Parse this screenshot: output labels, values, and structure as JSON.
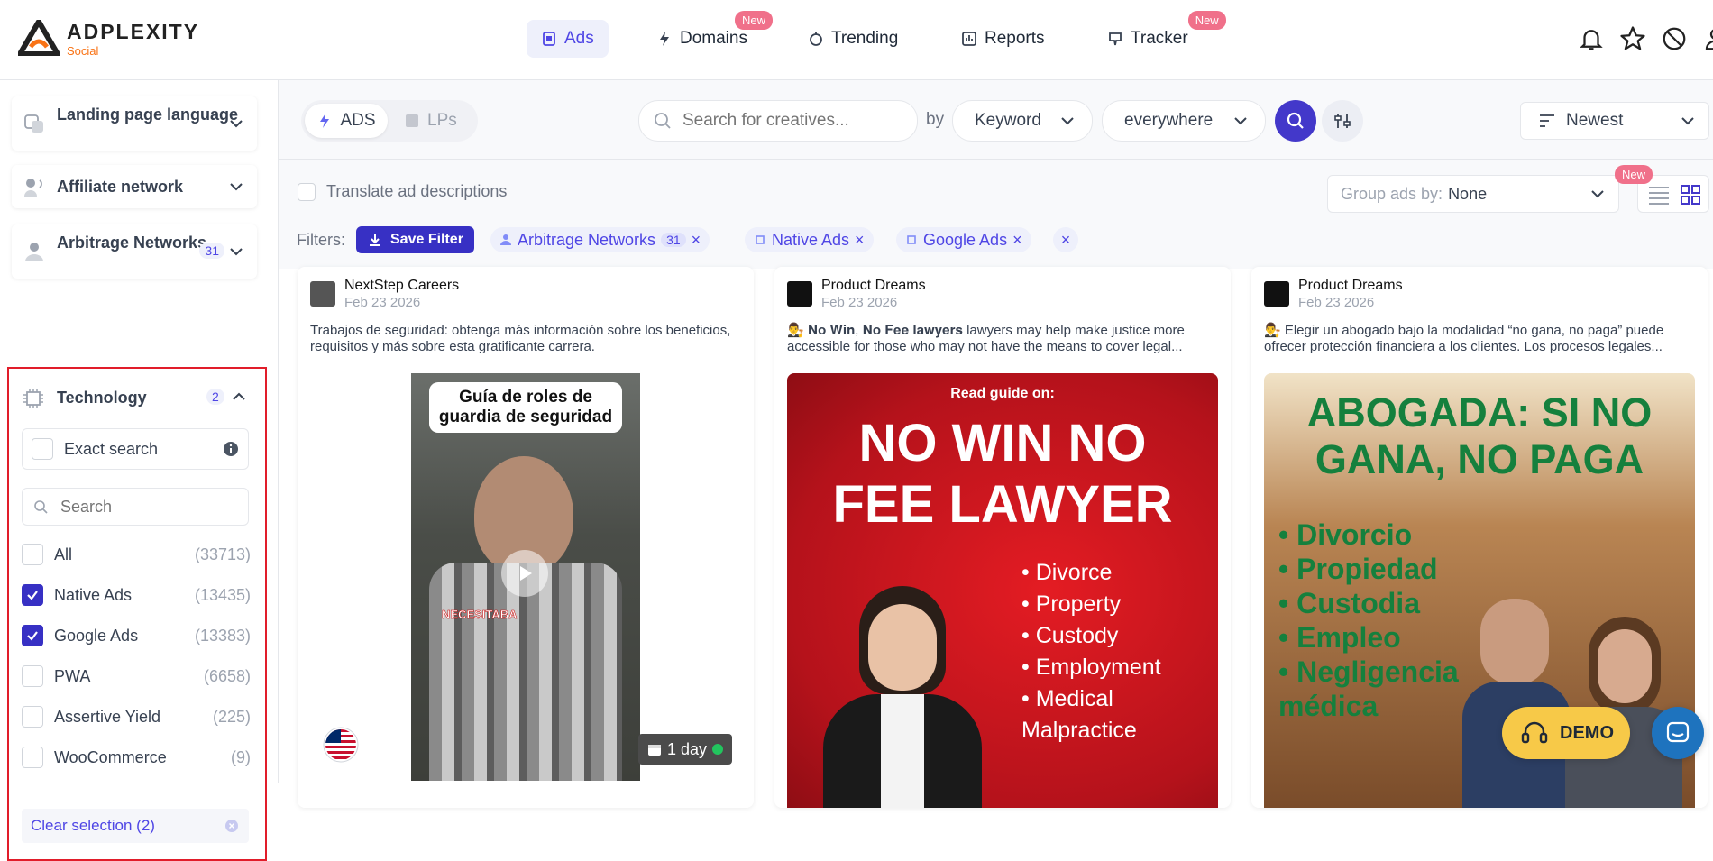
{
  "brand": {
    "name": "ADPLEXITY",
    "sub": "Social"
  },
  "nav": [
    {
      "label": "Ads",
      "active": true
    },
    {
      "label": "Domains",
      "badge": "New"
    },
    {
      "label": "Trending"
    },
    {
      "label": "Reports"
    },
    {
      "label": "Tracker",
      "badge": "New"
    }
  ],
  "sidebar": {
    "landing_language": "Landing page language",
    "affiliate_network": "Affiliate network",
    "arbitrage": {
      "label": "Arbitrage Networks",
      "count": "31"
    },
    "technology": {
      "label": "Technology",
      "count": "2",
      "exact_search": "Exact search",
      "search_placeholder": "Search",
      "options": [
        {
          "label": "All",
          "count": "(33713)",
          "checked": false
        },
        {
          "label": "Native Ads",
          "count": "(13435)",
          "checked": true
        },
        {
          "label": "Google Ads",
          "count": "(13383)",
          "checked": true
        },
        {
          "label": "PWA",
          "count": "(6658)",
          "checked": false
        },
        {
          "label": "Assertive Yield",
          "count": "(225)",
          "checked": false
        },
        {
          "label": "WooCommerce",
          "count": "(9)",
          "checked": false
        }
      ],
      "clear": "Clear selection (2)"
    }
  },
  "toolbar": {
    "tab_ads": "ADS",
    "tab_lps": "LPs",
    "search_placeholder": "Search for creatives...",
    "by": "by",
    "keyword": "Keyword",
    "where": "everywhere",
    "sort": "Newest"
  },
  "options_row": {
    "translate": "Translate ad descriptions",
    "group_by_label": "Group ads by:",
    "group_by_value": "None",
    "new_badge": "New"
  },
  "filters": {
    "label": "Filters:",
    "save": "Save Filter",
    "chips": [
      {
        "label": "Arbitrage Networks",
        "count": "31"
      },
      {
        "label": "Native Ads"
      },
      {
        "label": "Google Ads"
      }
    ]
  },
  "cards": [
    {
      "advertiser": "NextStep Careers",
      "date": "Feb 23 2026",
      "desc": "Trabajos de seguridad: obtenga más información sobre los beneficios, requisitos y más sobre esta gratificante carrera.",
      "img_title": "Guía de roles de guardia de seguridad",
      "overlay": "NECESITABA",
      "age": "1 day"
    },
    {
      "advertiser": "Product Dreams",
      "date": "Feb 23 2026",
      "desc": "👨‍⚖️ 𝐍𝐨 𝐖𝐢𝐧, 𝐍𝐨 𝐅𝐞𝐞 𝐥𝐚𝐰𝐲𝐞𝐫𝐬 lawyers may help make justice more accessible for those who may not have the means to cover legal...",
      "img_top": "Read guide on:",
      "img_title": "NO WIN NO FEE LAWYER",
      "bullets": [
        "Divorce",
        "Property",
        "Custody",
        "Employment",
        "Medical Malpractice"
      ]
    },
    {
      "advertiser": "Product Dreams",
      "date": "Feb 23 2026",
      "desc": "👨‍⚖️ Elegir un abogado bajo la modalidad “no gana, no paga” puede ofrecer protección financiera a los clientes. Los procesos legales...",
      "img_title": "ABOGADA: SI NO GANA, NO PAGA",
      "bullets": [
        "Divorcio",
        "Propiedad",
        "Custodia",
        "Empleo",
        "Negligencia médica"
      ]
    }
  ],
  "demo": "DEMO"
}
